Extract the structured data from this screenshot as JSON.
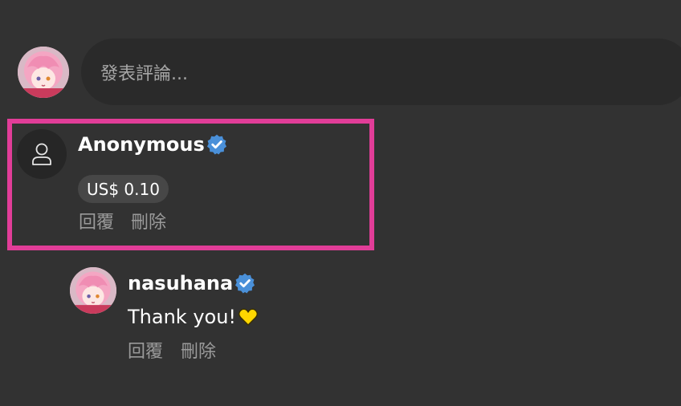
{
  "composer": {
    "placeholder": "發表評論..."
  },
  "comments": [
    {
      "author": "Anonymous",
      "verified": true,
      "amount": "US$ 0.10",
      "actions": {
        "reply": "回覆",
        "delete": "刪除"
      }
    }
  ],
  "replies": [
    {
      "author": "nasuhana",
      "verified": true,
      "text": "Thank you!",
      "emoji": "yellow-heart-icon",
      "actions": {
        "reply": "回覆",
        "delete": "刪除"
      }
    }
  ],
  "colors": {
    "background": "#323232",
    "input_background": "#2a2a2a",
    "highlight_border": "#e13d98",
    "verified_badge": "#4a90d9",
    "chip_background": "#474747",
    "muted_text": "#9a9a9a",
    "heart": "#ffd700"
  }
}
